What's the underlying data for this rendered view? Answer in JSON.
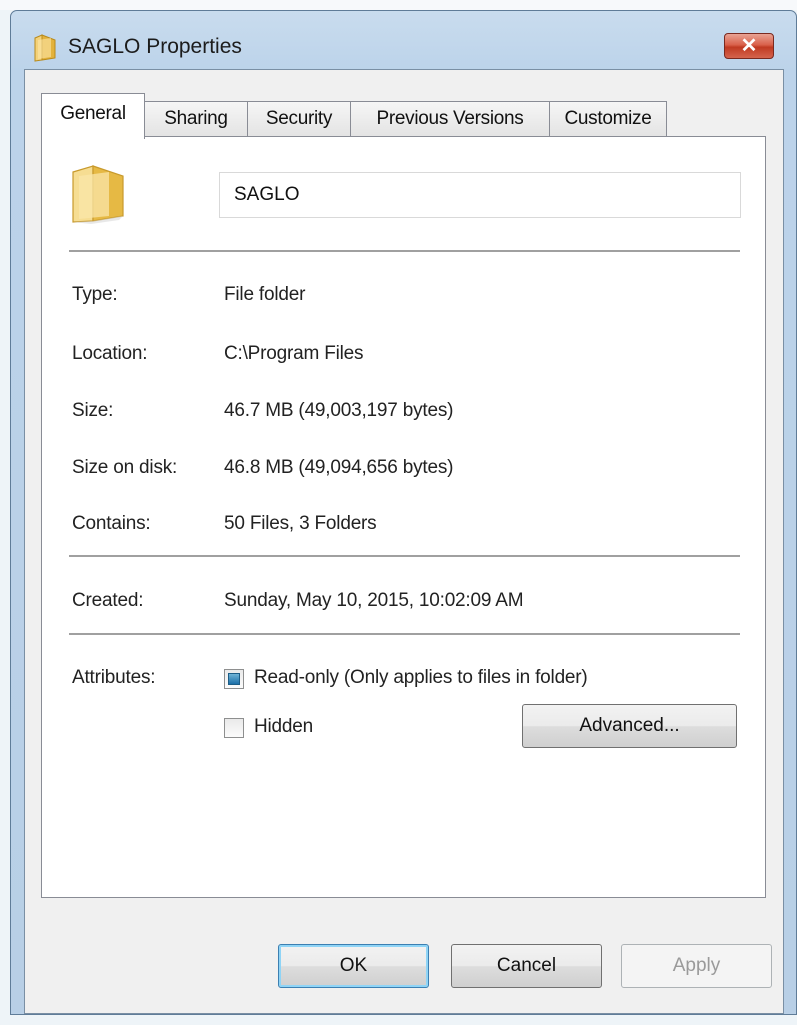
{
  "window": {
    "title": "SAGLO Properties",
    "close_label": "✕"
  },
  "tabs": [
    {
      "label": "General",
      "active": true
    },
    {
      "label": "Sharing",
      "active": false
    },
    {
      "label": "Security",
      "active": false
    },
    {
      "label": "Previous Versions",
      "active": false
    },
    {
      "label": "Customize",
      "active": false
    }
  ],
  "general": {
    "name_value": "SAGLO",
    "type_label": "Type:",
    "type_value": "File folder",
    "location_label": "Location:",
    "location_value": "C:\\Program Files",
    "size_label": "Size:",
    "size_value": "46.7 MB (49,003,197 bytes)",
    "size_on_disk_label": "Size on disk:",
    "size_on_disk_value": "46.8 MB (49,094,656 bytes)",
    "contains_label": "Contains:",
    "contains_value": "50 Files, 3 Folders",
    "created_label": "Created:",
    "created_value": "Sunday, May 10, 2015, 10:02:09 AM",
    "attributes_label": "Attributes:",
    "readonly_label": "Read-only (Only applies to files in folder)",
    "readonly_state": "indeterminate",
    "hidden_label": "Hidden",
    "hidden_checked": false,
    "advanced_label": "Advanced..."
  },
  "buttons": {
    "ok": "OK",
    "cancel": "Cancel",
    "apply": "Apply"
  },
  "colors": {
    "title_bar": "#bcd3ea",
    "close_button": "#c8452f",
    "checkbox_fill": "#1b6fa8",
    "folder": "#e8c25a"
  }
}
